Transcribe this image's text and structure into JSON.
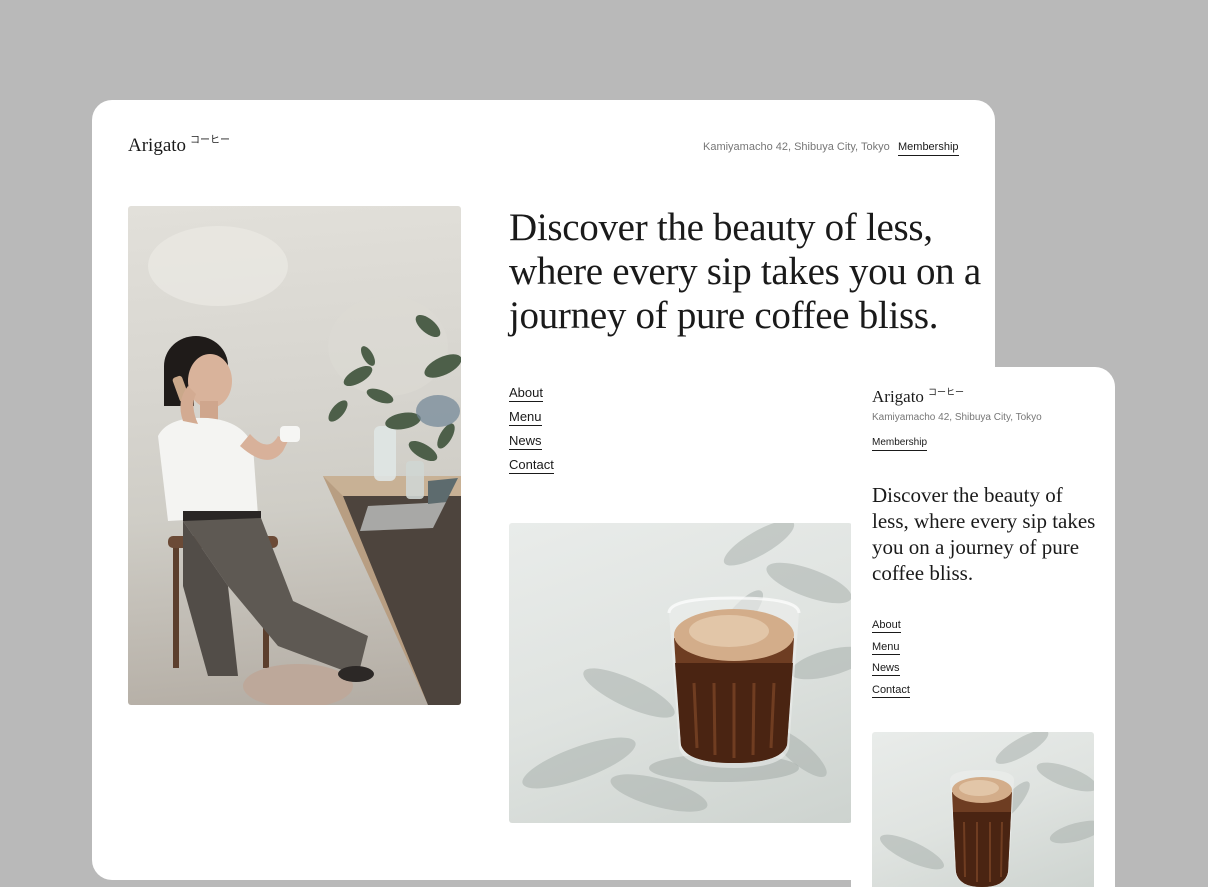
{
  "desktop": {
    "logo": {
      "word": "Arigato",
      "jp": "コーヒー"
    },
    "address": "Kamiyamacho 42, Shibuya City, Tokyo",
    "membership": "Membership",
    "heading": "Discover the beauty of less, where every sip takes you on a journey of pure coffee bliss.",
    "nav": [
      "About",
      "Menu",
      "News",
      "Contact"
    ]
  },
  "mobile": {
    "logo": {
      "word": "Arigato",
      "jp": "コーヒー"
    },
    "address": "Kamiyamacho 42, Shibuya City, Tokyo",
    "membership": "Membership",
    "heading": "Discover the beauty of less, where every sip takes you on a journey of pure coffee bliss.",
    "nav": [
      "About",
      "Menu",
      "News",
      "Contact"
    ]
  }
}
